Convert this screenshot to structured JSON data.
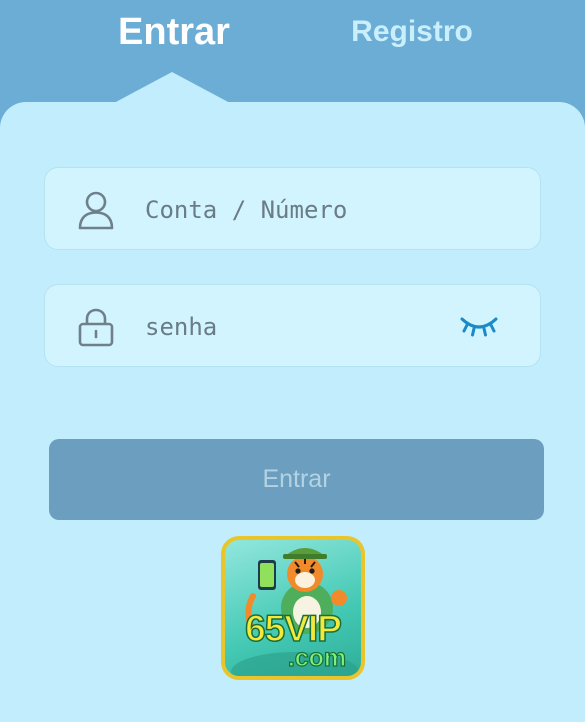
{
  "tabs": {
    "login_label": "Entrar",
    "register_label": "Registro"
  },
  "form": {
    "account_placeholder": "Conta / Número",
    "password_placeholder": "senha",
    "submit_label": "Entrar"
  },
  "logo": {
    "brand_text": "65VIP",
    "domain_text": ".com"
  },
  "colors": {
    "header_bg": "#6badd5",
    "panel_bg": "#c2edfc",
    "field_bg": "#d2f4fe",
    "button_bg": "#6c9fbf",
    "eye_icon": "#1a8ac8"
  },
  "icons": {
    "account_field": "user-icon",
    "password_field": "lock-icon",
    "password_toggle": "eye-closed-icon"
  }
}
